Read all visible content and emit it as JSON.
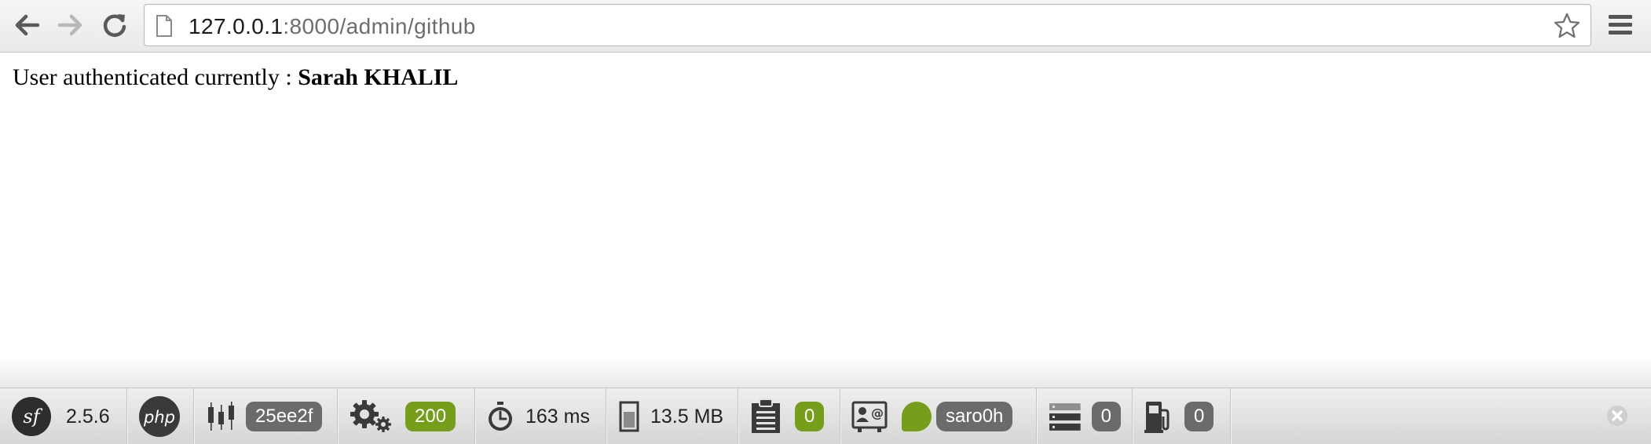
{
  "browser": {
    "url_host": "127.0.0.1",
    "url_rest": ":8000/admin/github",
    "icons": [
      "back-icon",
      "forward-icon",
      "reload-icon",
      "page-icon",
      "star-icon",
      "menu-icon"
    ]
  },
  "page": {
    "auth_label": "User authenticated currently : ",
    "auth_user": "Sarah KHALIL"
  },
  "debug_toolbar": {
    "symfony_version": "2.5.6",
    "token": "25ee2f",
    "status_code": "200",
    "time": "163 ms",
    "memory": "13.5 MB",
    "log_count": "0",
    "username": "saro0h",
    "db_queries": "0",
    "config_count": "0",
    "colors": {
      "success": "#759e1a",
      "neutral": "#6b6b6b"
    }
  }
}
